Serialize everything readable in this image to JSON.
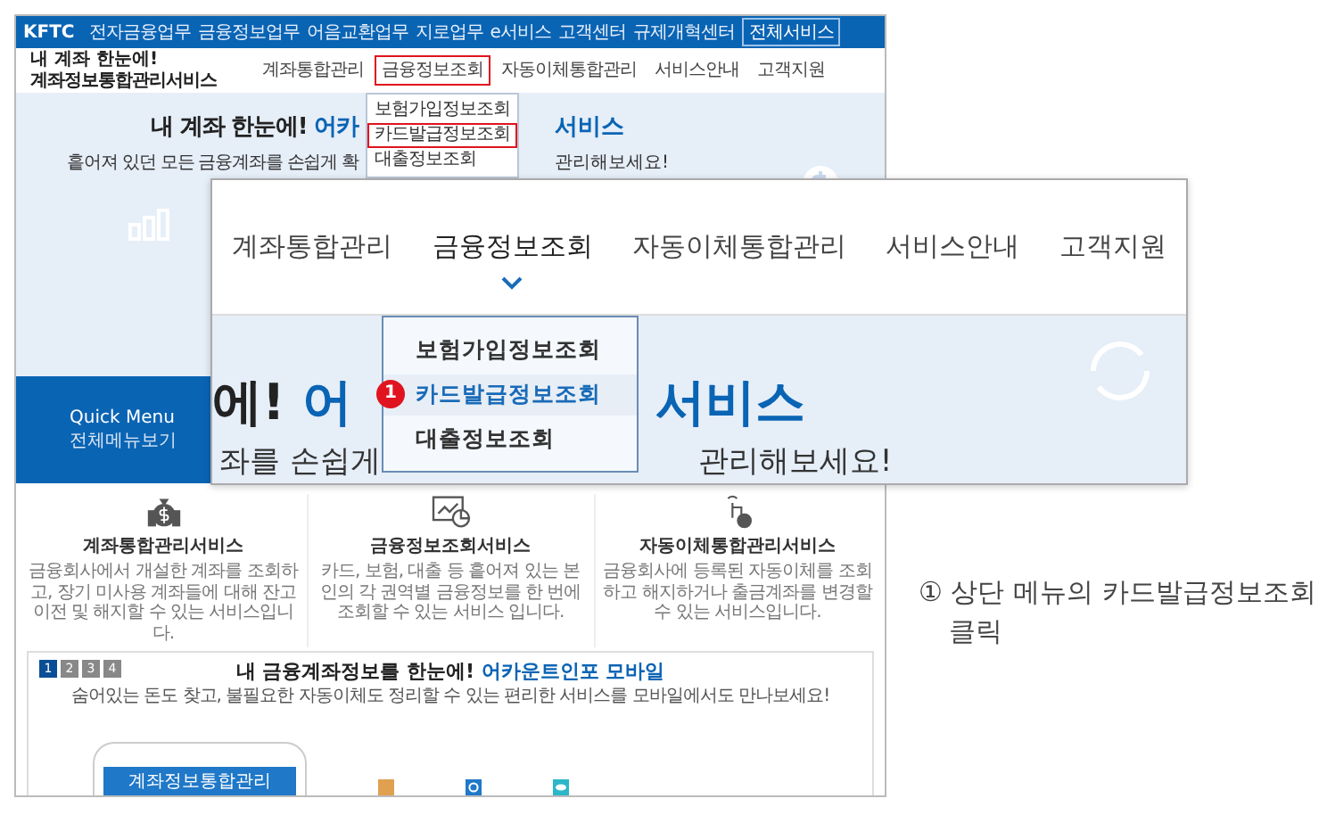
{
  "top_bar": {
    "logo": "KFTC",
    "links": [
      "전자금융업무",
      "금융정보업무",
      "어음교환업무",
      "지로업무",
      "e서비스",
      "고객센터",
      "규제개혁센터"
    ],
    "all_services": "전체서비스"
  },
  "header": {
    "tagline": "내 계좌 한눈에!",
    "site_name": "계좌정보통합관리서비스",
    "nav": [
      {
        "label": "계좌통합관리",
        "selected": false
      },
      {
        "label": "금융정보조회",
        "selected": true
      },
      {
        "label": "자동이체통합관리",
        "selected": false
      },
      {
        "label": "서비스안내",
        "selected": false
      },
      {
        "label": "고객지원",
        "selected": false
      }
    ],
    "dropdown": [
      {
        "label": "보험가입정보조회",
        "selected": false
      },
      {
        "label": "카드발급정보조회",
        "selected": true
      },
      {
        "label": "대출정보조회",
        "selected": false
      }
    ]
  },
  "hero": {
    "title_left": "내 계좌 한눈에! ",
    "title_left_accent": "어카",
    "title_right": "서비스",
    "subtitle_left": "흩어져 있던 모든 금융계좌를 손쉽게 확",
    "subtitle_right": "관리해보세요!",
    "quick_menu": "Quick Menu",
    "quick_menu_sub": "전체메뉴보기"
  },
  "services": [
    {
      "kind": "money",
      "title": "계좌통합관리서비스",
      "description": "금융회사에서 개설한 계좌를 조회하고, 장기 미사용 계좌들에 대해 잔고이전 및 해지할 수 있는 서비스입니다."
    },
    {
      "kind": "chart",
      "title": "금융정보조회서비스",
      "description": "카드, 보험, 대출 등 흩어져 있는 본인의 각 권역별 금융정보를 한 번에 조회할 수 있는 서비스 입니다."
    },
    {
      "kind": "hand",
      "title": "자동이체통합관리서비스",
      "description": "금융회사에 등록된 자동이체를 조회하고 해지하거나 출금계좌를 변경할 수 있는 서비스입니다."
    }
  ],
  "mobile": {
    "pages": [
      {
        "label": "1",
        "selected": true
      },
      {
        "label": "2",
        "selected": false
      },
      {
        "label": "3",
        "selected": false
      },
      {
        "label": "4",
        "selected": false
      }
    ],
    "title": "내 금융계좌정보를 한눈에! ",
    "title_accent": "어카운트인포 모바일",
    "subtitle": "숨어있는 돈도 찾고, 불필요한 자동이체도 정리할 수 있는 편리한 서비스를 모바일에서도 만나보세요!",
    "phone_bar": "계좌정보통합관리"
  },
  "zoom_panel": {
    "nav": [
      {
        "label": "계좌통합관리",
        "selected": false
      },
      {
        "label": "금융정보조회",
        "selected": true
      },
      {
        "label": "자동이체통합관리",
        "selected": false
      },
      {
        "label": "서비스안내",
        "selected": false
      },
      {
        "label": "고객지원",
        "selected": false
      }
    ],
    "dropdown": [
      {
        "label": "보험가입정보조회",
        "selected": false
      },
      {
        "label": "카드발급정보조회",
        "selected": true,
        "badge": "1"
      },
      {
        "label": "대출정보조회",
        "selected": false
      }
    ],
    "hero_left": "에! ",
    "hero_left_accent": "어",
    "hero_right": "서비스",
    "sub_left": "좌를 손쉽게",
    "sub_right": "관리해보세요!"
  },
  "caption": "① 상단 메뉴의 카드발급정보조회 클릭"
}
